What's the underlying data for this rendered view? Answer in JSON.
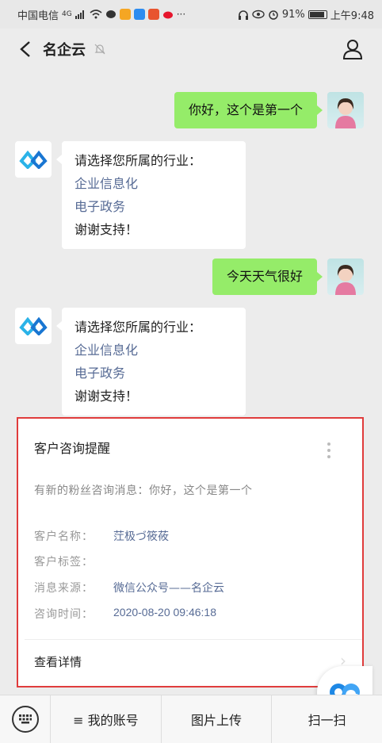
{
  "status_bar": {
    "carrier": "中国电信",
    "network": "4G",
    "battery": "91%",
    "time": "上午9:48"
  },
  "nav": {
    "back_icon": "chevron-left-icon",
    "title": "名企云",
    "mute_icon": "bell-off-icon",
    "profile_icon": "user-icon"
  },
  "messages": [
    {
      "sender": "me",
      "text": "你好，这个是第一个"
    },
    {
      "sender": "bot",
      "lines": [
        "请选择您所属的行业：",
        "企业信息化",
        "电子政务",
        "谢谢支持！"
      ]
    },
    {
      "sender": "me",
      "text": "今天天气很好"
    },
    {
      "sender": "bot",
      "lines": [
        "请选择您所属的行业：",
        "企业信息化",
        "电子政务",
        "谢谢支持！"
      ]
    }
  ],
  "card": {
    "title": "客户咨询提醒",
    "description": "有新的粉丝咨询消息：你好，这个是第一个",
    "rows": [
      {
        "label": "客户名称：",
        "value": "茳极づ筱莜"
      },
      {
        "label": "客户标签：",
        "value": ""
      },
      {
        "label": "消息来源：",
        "value": "微信公众号——名企云"
      },
      {
        "label": "咨询时间：",
        "value": "2020-08-20 09:46:18"
      }
    ],
    "detail_label": "查看详情"
  },
  "bottom_menu": {
    "keyboard_icon": "keyboard-icon",
    "items": [
      "≡ 我的账号",
      "图片上传",
      "扫一扫"
    ]
  },
  "colors": {
    "green_bubble": "#95ec69",
    "link": "#576b95",
    "highlight_border": "#e03c3c"
  }
}
